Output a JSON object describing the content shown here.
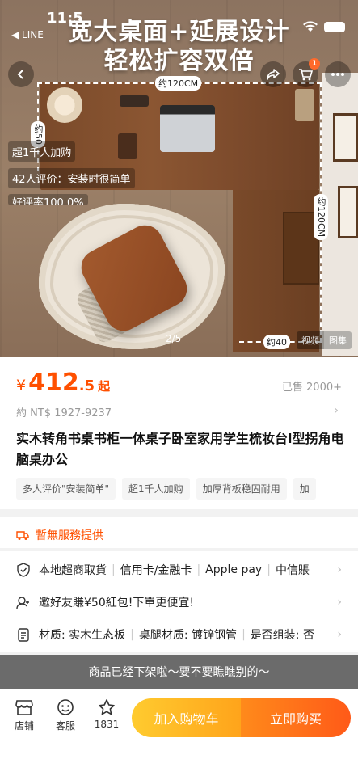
{
  "status_bar": {
    "time": "11:5",
    "back_app": "◀ LINE"
  },
  "hero": {
    "headline_line1": "宽大桌面+延展设计",
    "headline_line2": "轻松扩容双倍",
    "dim_top": "约120CM",
    "dim_left": "约50",
    "dim_right": "约120CM",
    "dim_bottom": "约40",
    "cart_count": "1",
    "overlay_tags": [
      "超1千人加购",
      "42人评价：安装时很简单",
      "好评率100.0%"
    ],
    "page_indicator": "2/5",
    "media_tabs": [
      "视频",
      "图集"
    ]
  },
  "price": {
    "currency": "¥",
    "integer": "412",
    "decimal": ".5",
    "suffix": "起",
    "sold": "已售 2000+",
    "ntd": "約 NT$ 1927-9237"
  },
  "product": {
    "title": "实木转角书桌书柜一体桌子卧室家用学生梳妆台l型拐角电脑桌办公",
    "chips": [
      "多人评价\"安装简单\"",
      "超1千人加购",
      "加厚背板稳固耐用",
      "加"
    ]
  },
  "service": {
    "label": "暫無服務提供"
  },
  "info_rows": [
    {
      "items": [
        "本地超商取貨",
        "信用卡/金融卡",
        "Apple pay",
        "中信賬"
      ]
    },
    {
      "items": [
        "邀好友賺¥50紅包!下單更便宜!"
      ]
    },
    {
      "items": [
        "材质: 实木生态板",
        "桌腿材质: 镀锌钢管",
        "是否组装: 否"
      ]
    }
  ],
  "off_shelf_notice": "商品已经下架啦～要不要瞧瞧别的～",
  "bottom_bar": {
    "shop": "店铺",
    "service": "客服",
    "favorites": "1831",
    "add_to_cart": "加入购物车",
    "buy_now": "立即购买"
  },
  "colors": {
    "accent": "#ff5000",
    "cart_btn": "#ffb020",
    "buy_btn": "#ff6a1b"
  }
}
